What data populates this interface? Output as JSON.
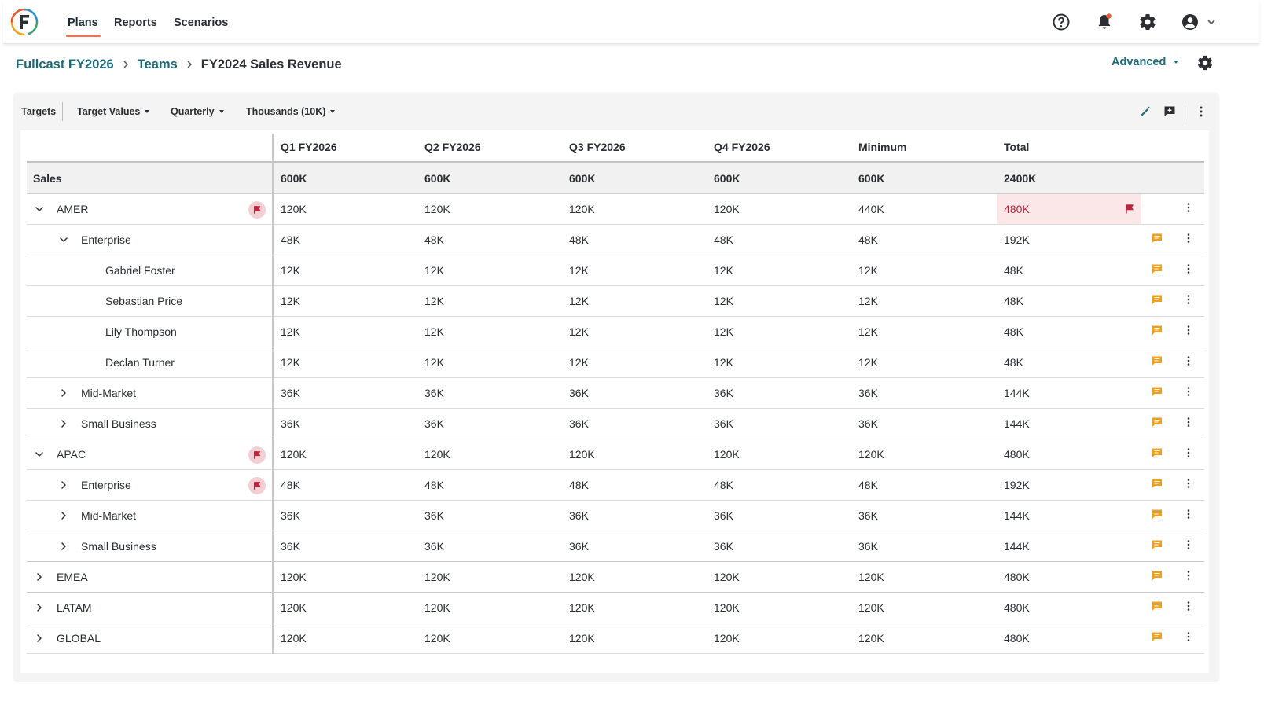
{
  "nav": {
    "tabs": [
      {
        "label": "Plans",
        "active": true
      },
      {
        "label": "Reports",
        "active": false
      },
      {
        "label": "Scenarios",
        "active": false
      }
    ],
    "icons": [
      "help-icon",
      "bell-icon",
      "gear-icon",
      "account-icon",
      "chevron-down-icon"
    ]
  },
  "breadcrumb": {
    "items": [
      "Fullcast FY2026",
      "Teams"
    ],
    "current": "FY2024 Sales Revenue"
  },
  "advanced_label": "Advanced",
  "toolbar": {
    "targets": "Targets",
    "target_values": "Target Values",
    "period": "Quarterly",
    "units": "Thousands (10K)"
  },
  "table": {
    "columns": [
      "Q1 FY2026",
      "Q2 FY2026",
      "Q3 FY2026",
      "Q4 FY2026",
      "Minimum",
      "Total"
    ],
    "summary": {
      "name": "Sales",
      "values": [
        "600K",
        "600K",
        "600K",
        "600K",
        "600K",
        "2400K"
      ]
    },
    "rows": [
      {
        "name": "AMER",
        "level": 0,
        "toggle": "expanded",
        "flag": true,
        "values": [
          "120K",
          "120K",
          "120K",
          "120K",
          "440K",
          "480K"
        ],
        "total_alert": true,
        "comment": false
      },
      {
        "name": "Enterprise",
        "level": 1,
        "toggle": "expanded",
        "flag": false,
        "values": [
          "48K",
          "48K",
          "48K",
          "48K",
          "48K",
          "192K"
        ],
        "comment": true
      },
      {
        "name": "Gabriel Foster",
        "level": 2,
        "toggle": "none",
        "flag": false,
        "values": [
          "12K",
          "12K",
          "12K",
          "12K",
          "12K",
          "48K"
        ],
        "comment": true
      },
      {
        "name": "Sebastian Price",
        "level": 2,
        "toggle": "none",
        "flag": false,
        "values": [
          "12K",
          "12K",
          "12K",
          "12K",
          "12K",
          "48K"
        ],
        "comment": true
      },
      {
        "name": "Lily Thompson",
        "level": 2,
        "toggle": "none",
        "flag": false,
        "values": [
          "12K",
          "12K",
          "12K",
          "12K",
          "12K",
          "48K"
        ],
        "comment": true
      },
      {
        "name": "Declan Turner",
        "level": 2,
        "toggle": "none",
        "flag": false,
        "values": [
          "12K",
          "12K",
          "12K",
          "12K",
          "12K",
          "48K"
        ],
        "comment": true
      },
      {
        "name": "Mid-Market",
        "level": 1,
        "toggle": "collapsed",
        "flag": false,
        "values": [
          "36K",
          "36K",
          "36K",
          "36K",
          "36K",
          "144K"
        ],
        "comment": true
      },
      {
        "name": "Small Business",
        "level": 1,
        "toggle": "collapsed",
        "flag": false,
        "values": [
          "36K",
          "36K",
          "36K",
          "36K",
          "36K",
          "144K"
        ],
        "comment": true,
        "group_end": true
      },
      {
        "name": "APAC",
        "level": 0,
        "toggle": "expanded",
        "flag": true,
        "values": [
          "120K",
          "120K",
          "120K",
          "120K",
          "120K",
          "480K"
        ],
        "comment": true
      },
      {
        "name": "Enterprise",
        "level": 1,
        "toggle": "collapsed",
        "flag": true,
        "values": [
          "48K",
          "48K",
          "48K",
          "48K",
          "48K",
          "192K"
        ],
        "comment": true
      },
      {
        "name": "Mid-Market",
        "level": 1,
        "toggle": "collapsed",
        "flag": false,
        "values": [
          "36K",
          "36K",
          "36K",
          "36K",
          "36K",
          "144K"
        ],
        "comment": true
      },
      {
        "name": "Small Business",
        "level": 1,
        "toggle": "collapsed",
        "flag": false,
        "values": [
          "36K",
          "36K",
          "36K",
          "36K",
          "36K",
          "144K"
        ],
        "comment": true,
        "group_end": true
      },
      {
        "name": "EMEA",
        "level": 0,
        "toggle": "collapsed",
        "flag": false,
        "values": [
          "120K",
          "120K",
          "120K",
          "120K",
          "120K",
          "480K"
        ],
        "comment": true,
        "group_end": true
      },
      {
        "name": "LATAM",
        "level": 0,
        "toggle": "collapsed",
        "flag": false,
        "values": [
          "120K",
          "120K",
          "120K",
          "120K",
          "120K",
          "480K"
        ],
        "comment": true,
        "group_end": true
      },
      {
        "name": "GLOBAL",
        "level": 0,
        "toggle": "collapsed",
        "flag": false,
        "values": [
          "120K",
          "120K",
          "120K",
          "120K",
          "120K",
          "480K"
        ],
        "comment": true
      }
    ]
  },
  "colors": {
    "brand_teal": "#1c6b7a",
    "nav_accent": "#e8735a",
    "flag_red": "#c0253d",
    "flag_bg": "#f3cfd3",
    "alert_bg": "#fbe6e8",
    "comment_orange": "#f0a020",
    "notification_dot": "#e8572f"
  }
}
